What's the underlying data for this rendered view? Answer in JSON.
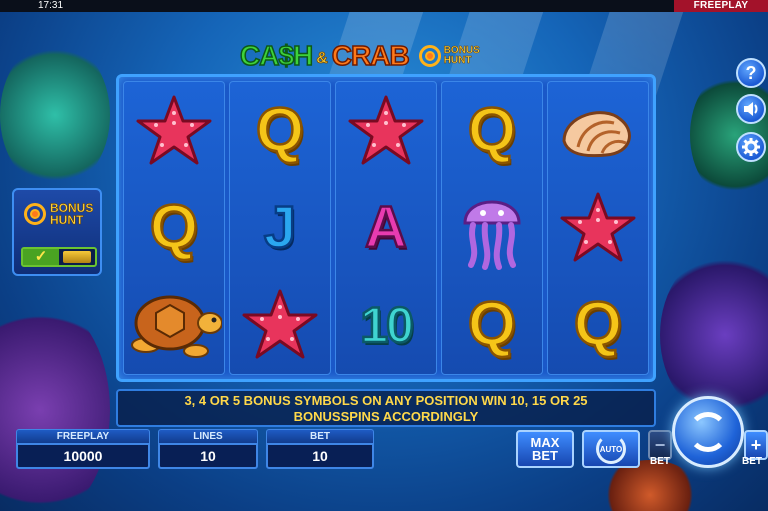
{
  "status_bar": {
    "time": "17:31",
    "mode": "FREEPLAY"
  },
  "logo": {
    "cash": "CA$H",
    "amp": "&",
    "crab": "CRAB",
    "bonus_hunt_line1": "BONUS",
    "bonus_hunt_line2": "HUNT"
  },
  "reels": [
    [
      "starfish",
      "Q",
      "turtle"
    ],
    [
      "Q",
      "J",
      "starfish"
    ],
    [
      "starfish",
      "A",
      "10"
    ],
    [
      "Q",
      "jellyfish",
      "Q"
    ],
    [
      "shell",
      "starfish",
      "Q"
    ]
  ],
  "banner": {
    "line1": "3, 4 OR 5 BONUS SYMBOLS ON ANY POSITION WIN 10, 15 OR 25",
    "line2": "BONUSSPINS ACCORDINGLY"
  },
  "bonus_hunt_panel": {
    "label_line1": "BONUS",
    "label_line2": "HUNT",
    "enabled": true,
    "check_glyph": "✓"
  },
  "side_buttons": {
    "help": "?",
    "sound_icon": "speaker-icon",
    "settings_icon": "gear-icon"
  },
  "bottom": {
    "freeplay_label": "FREEPLAY",
    "freeplay_value": "10000",
    "lines_label": "LINES",
    "lines_value": "10",
    "bet_label": "BET",
    "bet_value": "10",
    "maxbet_line1": "MAX",
    "maxbet_line2": "BET",
    "auto_label": "AUTO",
    "bet_minus_caption": "BET",
    "bet_plus_caption": "BET",
    "minus_glyph": "−",
    "plus_glyph": "+"
  },
  "colors": {
    "reel_bg": "#1a58c8",
    "banner_text": "#ffd84a",
    "brand_green": "#3ed23a",
    "brand_orange": "#ff7a1a"
  }
}
